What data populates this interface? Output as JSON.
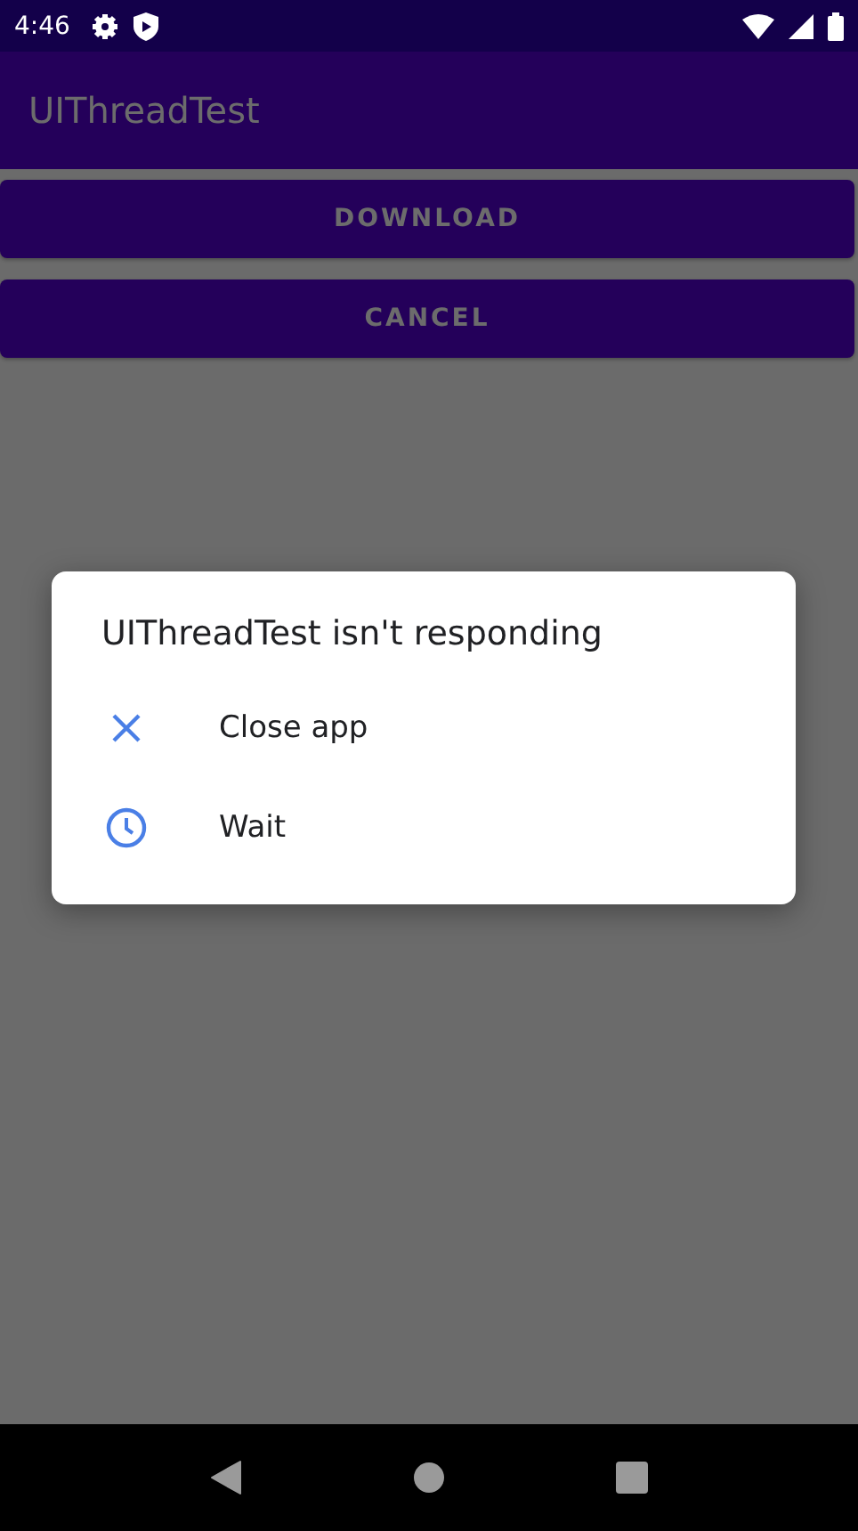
{
  "status_bar": {
    "time": "4:46"
  },
  "app_bar": {
    "title": "UIThreadTest"
  },
  "buttons": [
    "DOWNLOAD",
    "CANCEL"
  ],
  "dialog": {
    "title": "UIThreadTest isn't responding",
    "options": [
      {
        "kind": "close",
        "label": "Close app"
      },
      {
        "kind": "wait",
        "label": "Wait"
      }
    ]
  }
}
